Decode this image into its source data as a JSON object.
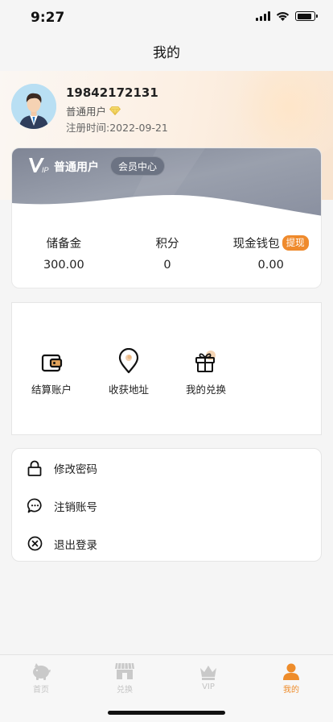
{
  "status": {
    "time": "9:27",
    "battery_level": 0.85
  },
  "nav": {
    "title": "我的"
  },
  "profile": {
    "phone": "19842172131",
    "level": "普通用户",
    "registered_label": "注册时间:",
    "registered_date": "2022-09-21"
  },
  "vip": {
    "title": "普通用户",
    "member_center": "会员中心",
    "stats": [
      {
        "label": "储备金",
        "value": "300.00"
      },
      {
        "label": "积分",
        "value": "0"
      },
      {
        "label": "现金钱包",
        "value": "0.00",
        "badge": "提现"
      }
    ]
  },
  "grid": [
    {
      "label": "结算账户",
      "icon": "wallet-icon"
    },
    {
      "label": "收获地址",
      "icon": "location-pin-icon"
    },
    {
      "label": "我的兑换",
      "icon": "gift-icon"
    }
  ],
  "list": [
    {
      "label": "修改密码",
      "icon": "lock-icon"
    },
    {
      "label": "注销账号",
      "icon": "chat-bubble-icon"
    },
    {
      "label": "退出登录",
      "icon": "close-circle-icon"
    }
  ],
  "tabs": [
    {
      "label": "首页",
      "icon": "piggy-bank-icon"
    },
    {
      "label": "兑换",
      "icon": "shop-icon"
    },
    {
      "label": "VIP",
      "icon": "crown-icon"
    },
    {
      "label": "我的",
      "icon": "person-icon",
      "active": true
    }
  ],
  "colors": {
    "accent": "#ee8c2a",
    "vip_band": "#8d93a1",
    "tab_inactive": "#c4c4c4"
  }
}
